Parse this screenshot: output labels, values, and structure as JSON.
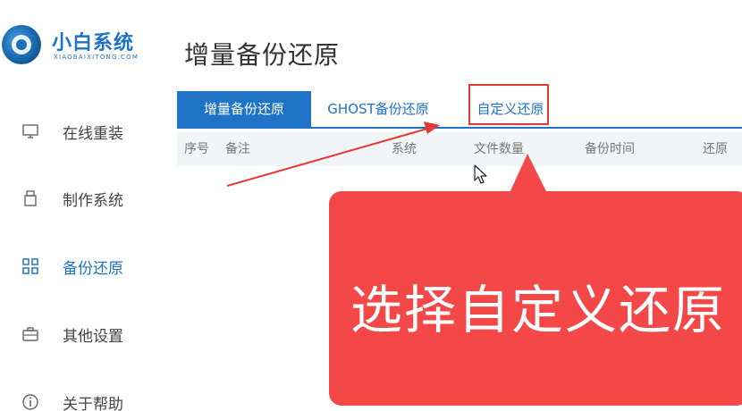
{
  "brand": {
    "title": "小白系统",
    "subtitle": "XIAOBAIXITONG.COM"
  },
  "sidebar": {
    "items": [
      {
        "label": "在线重装",
        "icon": "monitor-icon"
      },
      {
        "label": "制作系统",
        "icon": "usb-icon"
      },
      {
        "label": "备份还原",
        "icon": "backup-grid-icon",
        "active": true
      },
      {
        "label": "其他设置",
        "icon": "briefcase-icon"
      },
      {
        "label": "关于帮助",
        "icon": "info-icon"
      }
    ]
  },
  "page": {
    "title": "增量备份还原"
  },
  "tabs": [
    {
      "label": "增量备份还原",
      "active": true
    },
    {
      "label": "GHOST备份还原"
    },
    {
      "label": "自定义还原",
      "highlighted": true
    }
  ],
  "table": {
    "headers": [
      "序号",
      "备注",
      "系统",
      "文件数量",
      "备份时间",
      "还原"
    ]
  },
  "callout": {
    "text": "选择自定义还原"
  },
  "colors": {
    "accent": "#1e73c6",
    "callout": "#f44747",
    "highlight": "#e53935"
  }
}
